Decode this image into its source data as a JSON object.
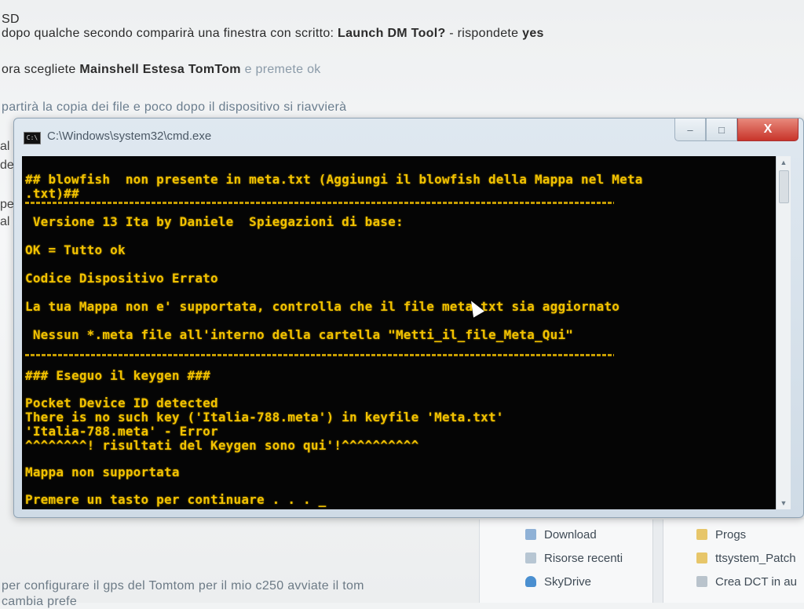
{
  "page": {
    "lines": {
      "l0": "SD",
      "l1_pre": "dopo qualche secondo comparirà una finestra con scritto: ",
      "l1_bold1": "Launch DM Tool?",
      "l1_mid": " - rispondete ",
      "l1_bold2": "yes",
      "l2_pre": "ora scegliete ",
      "l2_bold": "Mainshell Estesa TomTom",
      "l2_post": " e premete ok",
      "l3": "partirà la copia dei file e poco dopo il dispositivo si riavvierà",
      "stub_a": "al",
      "stub_b": "de",
      "stub_c": "pe",
      "stub_d": "al",
      "bottom1": "per configurare il gps del Tomtom per il mio c250 avviate il tom",
      "bottom2": "cambia prefe"
    }
  },
  "explorer": {
    "left_items": [
      {
        "label": "Download",
        "icon": "download-folder-icon",
        "color": "#8fb1d6"
      },
      {
        "label": "Risorse recenti",
        "icon": "recent-places-icon",
        "color": "#b7c6d3"
      },
      {
        "label": "SkyDrive",
        "icon": "skydrive-cloud-icon",
        "color": "#4a8fd0"
      }
    ],
    "right_items": [
      {
        "label": "Progs",
        "icon": "folder-icon",
        "color": "#e7c66a"
      },
      {
        "label": "ttsystem_Patch",
        "icon": "folder-icon",
        "color": "#e7c66a"
      },
      {
        "label": "Crea DCT in au",
        "icon": "file-icon",
        "color": "#b9c3cc"
      }
    ]
  },
  "cmd": {
    "title": "C:\\Windows\\system32\\cmd.exe",
    "icon_label": "C:\\",
    "buttons": {
      "minimize": "‒",
      "maximize": "□",
      "close": "X"
    },
    "lines": {
      "a1": "## blowfish  non presente in meta.txt (Aggiungi il blowfish della Mappa nel Meta",
      "a2": ".txt)##",
      "b": " Versione 13 Ita by Daniele  Spiegazioni di base:",
      "c": "OK = Tutto ok",
      "d": "Codice Dispositivo Errato",
      "e": "La tua Mappa non e' supportata, controlla che il file meta.txt sia aggiornato",
      "f": " Nessun *.meta file all'interno della cartella \"Metti_il_file_Meta_Qui\"",
      "g": "### Eseguo il keygen ###",
      "h": "Pocket Device ID detected",
      "i": "There is no such key ('Italia-788.meta') in keyfile 'Meta.txt'",
      "j": "'Italia-788.meta' - Error",
      "k": "^^^^^^^^! risultati del Keygen sono qui'!^^^^^^^^^^",
      "l": "Mappa non supportata",
      "m": "Premere un tasto per continuare . . . _"
    }
  }
}
